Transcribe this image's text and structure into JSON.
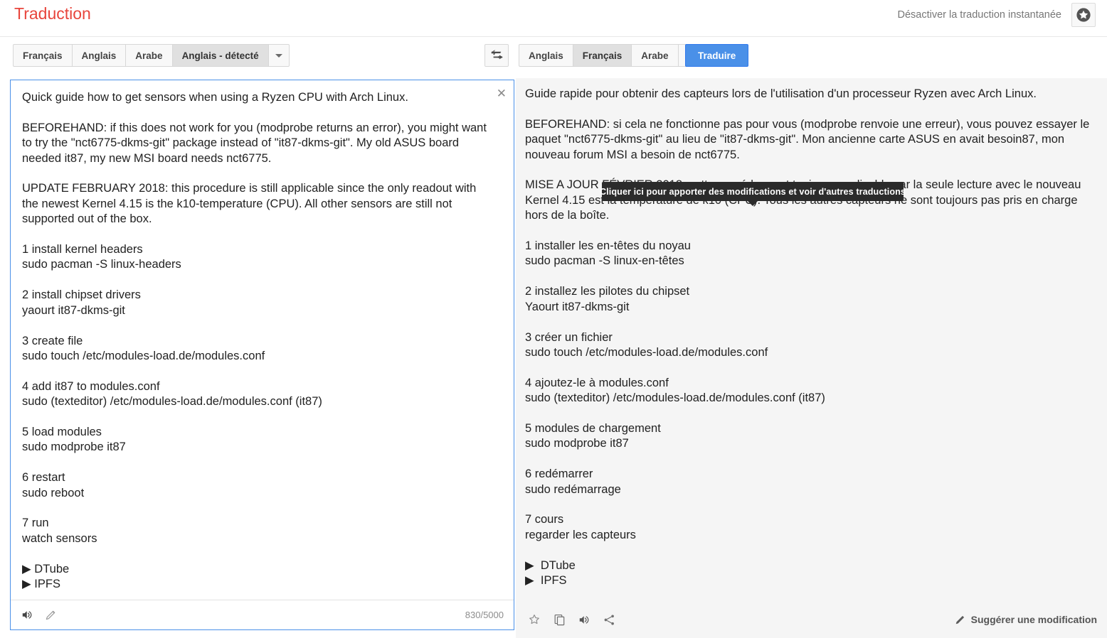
{
  "header": {
    "brand": "Traduction",
    "instant_translation_toggle": "Désactiver la traduction instantanée",
    "star_icon": "star-circle-icon"
  },
  "source_langbar": {
    "buttons": [
      {
        "label": "Français",
        "selected": false
      },
      {
        "label": "Anglais",
        "selected": false
      },
      {
        "label": "Arabe",
        "selected": false
      },
      {
        "label": "Anglais - détecté",
        "selected": true
      }
    ],
    "more_icon": "chevron-down-icon"
  },
  "swap": {
    "icon": "swap-languages-icon"
  },
  "target_langbar": {
    "buttons": [
      {
        "label": "Anglais",
        "selected": false
      },
      {
        "label": "Français",
        "selected": true
      },
      {
        "label": "Arabe",
        "selected": false
      }
    ],
    "more_icon": "chevron-down-icon"
  },
  "translate_button": {
    "label": "Traduire",
    "color": "#4a90e8"
  },
  "source_panel": {
    "close_icon": "close-icon",
    "text": "Quick guide how to get sensors when using a Ryzen CPU with Arch Linux.\n\nBEFOREHAND: if this does not work for you (modprobe returns an error), you might want to try the \"nct6775-dkms-git\" package instead of \"it87-dkms-git\". My old ASUS board needed it87, my new MSI board needs nct6775.\n\nUPDATE FEBRUARY 2018: this procedure is still applicable since the only readout with the newest Kernel 4.15 is the k10-temperature (CPU). All other sensors are still not supported out of the box.\n\n1 install kernel headers\nsudo pacman -S linux-headers\n\n2 install chipset drivers\nyaourt it87-dkms-git\n\n3 create file\nsudo touch /etc/modules-load.de/modules.conf\n\n4 add it87 to modules.conf\nsudo (texteditor) /etc/modules-load.de/modules.conf (it87)\n\n5 load modules\nsudo modprobe it87\n\n6 restart\nsudo reboot\n\n7 run\nwatch sensors\n\n▶ DTube\n▶ IPFS",
    "footer": {
      "listen_icon": "speaker-icon",
      "edit_icon": "pencil-icon",
      "char_count": "830/5000"
    }
  },
  "target_panel": {
    "text": "Guide rapide pour obtenir des capteurs lors de l'utilisation d'un processeur Ryzen avec Arch Linux.\n\nBEFOREHAND: si cela ne fonctionne pas pour vous (modprobe renvoie une erreur), vous pouvez essayer le paquet \"nct6775-dkms-git\" au lieu de \"it87-dkms-git\". Mon ancienne carte ASUS en avait besoin87, mon nouveau forum MSI a besoin de nct6775.\n\nMISE A JOUR FÉVRIER 2018: cette procédure est toujours applicable car la seule lecture avec le nouveau Kernel 4.15 est la température de k10 (CPU). Tous les autres capteurs ne sont toujours pas pris en charge hors de la boîte.\n\n1 installer les en-têtes du noyau\nsudo pacman -S linux-en-têtes\n\n2 installez les pilotes du chipset\nYaourt it87-dkms-git\n\n3 créer un fichier\nsudo touch /etc/modules-load.de/modules.conf\n\n4 ajoutez-le à modules.conf\nsudo (texteditor) /etc/modules-load.de/modules.conf (it87)\n\n5 modules de chargement\nsudo modprobe it87\n\n6 redémarrer\nsudo redémarrage\n\n7 cours\nregarder les capteurs\n\n▶  DTube\n▶  IPFS",
    "footer": {
      "star_icon": "star-outline-icon",
      "copy_icon": "copy-icon",
      "listen_icon": "speaker-icon",
      "share_icon": "share-icon",
      "suggest_edit_icon": "pencil-filled-icon",
      "suggest_edit_label": "Suggérer une modification"
    }
  },
  "tooltip": {
    "text": "Cliquer ici pour apporter des modifications et voir d'autres traductions",
    "background": "#2b2b2b"
  }
}
